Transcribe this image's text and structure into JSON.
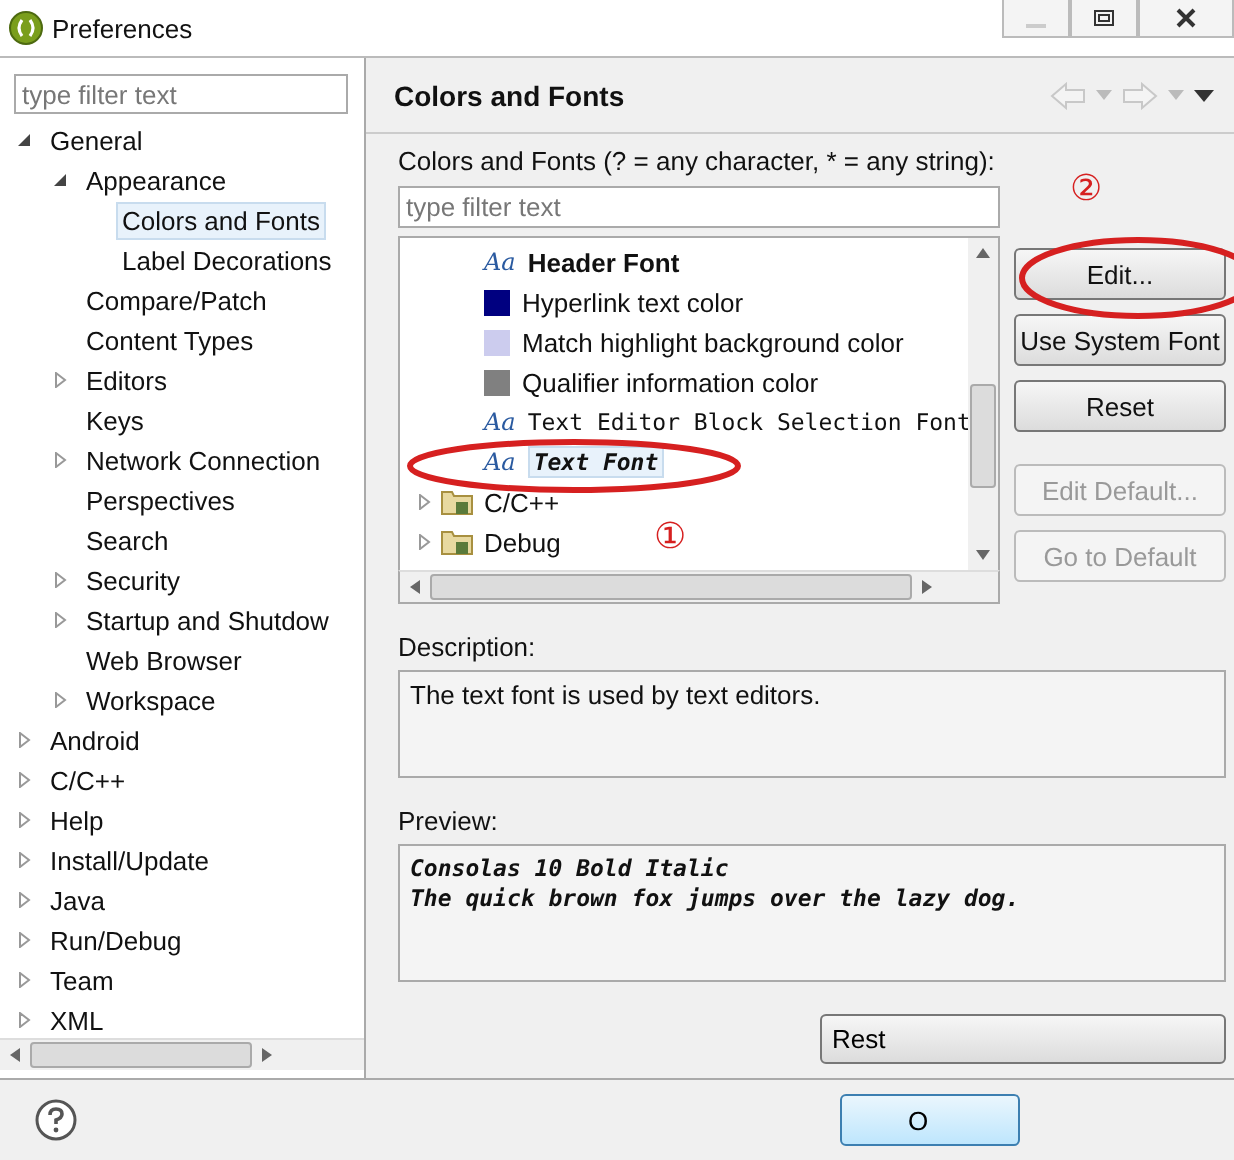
{
  "window": {
    "title": "Preferences"
  },
  "sidebar": {
    "filter": {
      "placeholder": "type filter text"
    },
    "tree": [
      {
        "label": "General",
        "expanded": true,
        "selected": false,
        "children": [
          {
            "label": "Appearance",
            "expanded": true,
            "selected": false,
            "children": [
              {
                "label": "Colors and Fonts",
                "selected": true
              },
              {
                "label": "Label Decorations",
                "selected": false
              }
            ]
          },
          {
            "label": "Compare/Patch",
            "selected": false
          },
          {
            "label": "Content Types",
            "selected": false
          },
          {
            "label": "Editors",
            "expanded": false,
            "selected": false
          },
          {
            "label": "Keys",
            "selected": false
          },
          {
            "label": "Network Connection",
            "expanded": false,
            "selected": false
          },
          {
            "label": "Perspectives",
            "selected": false
          },
          {
            "label": "Search",
            "selected": false
          },
          {
            "label": "Security",
            "expanded": false,
            "selected": false
          },
          {
            "label": "Startup and Shutdow",
            "expanded": false,
            "selected": false
          },
          {
            "label": "Web Browser",
            "selected": false
          },
          {
            "label": "Workspace",
            "expanded": false,
            "selected": false
          }
        ]
      },
      {
        "label": "Android",
        "expanded": false,
        "selected": false
      },
      {
        "label": "C/C++",
        "expanded": false,
        "selected": false
      },
      {
        "label": "Help",
        "expanded": false,
        "selected": false
      },
      {
        "label": "Install/Update",
        "expanded": false,
        "selected": false
      },
      {
        "label": "Java",
        "expanded": false,
        "selected": false
      },
      {
        "label": "Run/Debug",
        "expanded": false,
        "selected": false
      },
      {
        "label": "Team",
        "expanded": false,
        "selected": false
      },
      {
        "label": "XML",
        "expanded": false,
        "selected": false
      }
    ]
  },
  "page": {
    "title": "Colors and Fonts",
    "filter_label": "Colors and Fonts (? = any character, * = any string):",
    "filter": {
      "placeholder": "type filter text"
    },
    "entries": [
      {
        "kind": "bold-font",
        "icon": "Aa",
        "label": "Header Font",
        "selected": false
      },
      {
        "kind": "color",
        "color": "#000080",
        "label": "Hyperlink text color",
        "selected": false
      },
      {
        "kind": "color",
        "color": "#ccccee",
        "label": "Match highlight background color",
        "selected": false
      },
      {
        "kind": "color",
        "color": "#808080",
        "label": "Qualifier information color",
        "selected": false
      },
      {
        "kind": "mono-font",
        "icon": "Aa",
        "label": "Text Editor Block Selection Font",
        "selected": false
      },
      {
        "kind": "italic-mono-font",
        "icon": "Aa",
        "label": "Text Font",
        "selected": true
      },
      {
        "kind": "category",
        "label": "C/C++",
        "expanded": false,
        "selected": false
      },
      {
        "kind": "category",
        "label": "Debug",
        "expanded": false,
        "selected": false
      }
    ],
    "buttons": [
      {
        "label": "Edit...",
        "disabled": false
      },
      {
        "label": "Use System Font",
        "disabled": false
      },
      {
        "label": "Reset",
        "disabled": false
      },
      {
        "label": "Edit Default...",
        "disabled": true
      },
      {
        "label": "Go to Default",
        "disabled": true
      }
    ],
    "description_label": "Description:",
    "description": "The text font is used by text editors.",
    "preview_label": "Preview:",
    "preview": [
      "Consolas 10 Bold Italic",
      "The quick brown fox jumps over the lazy dog."
    ],
    "restore_button": "Rest"
  },
  "annotations": [
    "①",
    "②"
  ],
  "footer": {
    "ok_button": "O"
  }
}
